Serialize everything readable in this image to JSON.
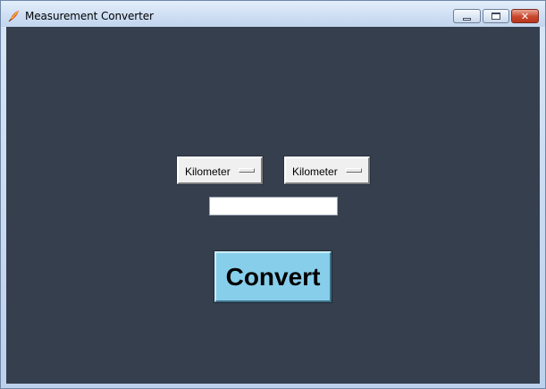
{
  "window": {
    "title": "Measurement Converter",
    "icon": "app-feather-icon",
    "controls": {
      "minimize": "minimize-icon",
      "maximize": "maximize-icon",
      "close": "close-icon",
      "close_glyph": "✕"
    }
  },
  "form": {
    "from_unit": "Kilometer",
    "to_unit": "Kilometer",
    "value_input": "",
    "convert_label": "Convert"
  },
  "colors": {
    "client_bg": "#353f4e",
    "convert_bg": "#87ceeb"
  }
}
